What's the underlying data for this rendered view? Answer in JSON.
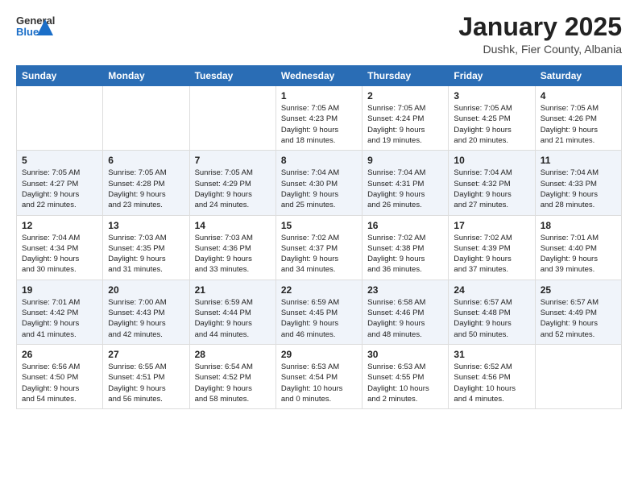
{
  "header": {
    "logo_general": "General",
    "logo_blue": "Blue",
    "calendar_title": "January 2025",
    "calendar_subtitle": "Dushk, Fier County, Albania"
  },
  "weekdays": [
    "Sunday",
    "Monday",
    "Tuesday",
    "Wednesday",
    "Thursday",
    "Friday",
    "Saturday"
  ],
  "rows": [
    [
      {
        "day": "",
        "info": ""
      },
      {
        "day": "",
        "info": ""
      },
      {
        "day": "",
        "info": ""
      },
      {
        "day": "1",
        "info": "Sunrise: 7:05 AM\nSunset: 4:23 PM\nDaylight: 9 hours\nand 18 minutes."
      },
      {
        "day": "2",
        "info": "Sunrise: 7:05 AM\nSunset: 4:24 PM\nDaylight: 9 hours\nand 19 minutes."
      },
      {
        "day": "3",
        "info": "Sunrise: 7:05 AM\nSunset: 4:25 PM\nDaylight: 9 hours\nand 20 minutes."
      },
      {
        "day": "4",
        "info": "Sunrise: 7:05 AM\nSunset: 4:26 PM\nDaylight: 9 hours\nand 21 minutes."
      }
    ],
    [
      {
        "day": "5",
        "info": "Sunrise: 7:05 AM\nSunset: 4:27 PM\nDaylight: 9 hours\nand 22 minutes."
      },
      {
        "day": "6",
        "info": "Sunrise: 7:05 AM\nSunset: 4:28 PM\nDaylight: 9 hours\nand 23 minutes."
      },
      {
        "day": "7",
        "info": "Sunrise: 7:05 AM\nSunset: 4:29 PM\nDaylight: 9 hours\nand 24 minutes."
      },
      {
        "day": "8",
        "info": "Sunrise: 7:04 AM\nSunset: 4:30 PM\nDaylight: 9 hours\nand 25 minutes."
      },
      {
        "day": "9",
        "info": "Sunrise: 7:04 AM\nSunset: 4:31 PM\nDaylight: 9 hours\nand 26 minutes."
      },
      {
        "day": "10",
        "info": "Sunrise: 7:04 AM\nSunset: 4:32 PM\nDaylight: 9 hours\nand 27 minutes."
      },
      {
        "day": "11",
        "info": "Sunrise: 7:04 AM\nSunset: 4:33 PM\nDaylight: 9 hours\nand 28 minutes."
      }
    ],
    [
      {
        "day": "12",
        "info": "Sunrise: 7:04 AM\nSunset: 4:34 PM\nDaylight: 9 hours\nand 30 minutes."
      },
      {
        "day": "13",
        "info": "Sunrise: 7:03 AM\nSunset: 4:35 PM\nDaylight: 9 hours\nand 31 minutes."
      },
      {
        "day": "14",
        "info": "Sunrise: 7:03 AM\nSunset: 4:36 PM\nDaylight: 9 hours\nand 33 minutes."
      },
      {
        "day": "15",
        "info": "Sunrise: 7:02 AM\nSunset: 4:37 PM\nDaylight: 9 hours\nand 34 minutes."
      },
      {
        "day": "16",
        "info": "Sunrise: 7:02 AM\nSunset: 4:38 PM\nDaylight: 9 hours\nand 36 minutes."
      },
      {
        "day": "17",
        "info": "Sunrise: 7:02 AM\nSunset: 4:39 PM\nDaylight: 9 hours\nand 37 minutes."
      },
      {
        "day": "18",
        "info": "Sunrise: 7:01 AM\nSunset: 4:40 PM\nDaylight: 9 hours\nand 39 minutes."
      }
    ],
    [
      {
        "day": "19",
        "info": "Sunrise: 7:01 AM\nSunset: 4:42 PM\nDaylight: 9 hours\nand 41 minutes."
      },
      {
        "day": "20",
        "info": "Sunrise: 7:00 AM\nSunset: 4:43 PM\nDaylight: 9 hours\nand 42 minutes."
      },
      {
        "day": "21",
        "info": "Sunrise: 6:59 AM\nSunset: 4:44 PM\nDaylight: 9 hours\nand 44 minutes."
      },
      {
        "day": "22",
        "info": "Sunrise: 6:59 AM\nSunset: 4:45 PM\nDaylight: 9 hours\nand 46 minutes."
      },
      {
        "day": "23",
        "info": "Sunrise: 6:58 AM\nSunset: 4:46 PM\nDaylight: 9 hours\nand 48 minutes."
      },
      {
        "day": "24",
        "info": "Sunrise: 6:57 AM\nSunset: 4:48 PM\nDaylight: 9 hours\nand 50 minutes."
      },
      {
        "day": "25",
        "info": "Sunrise: 6:57 AM\nSunset: 4:49 PM\nDaylight: 9 hours\nand 52 minutes."
      }
    ],
    [
      {
        "day": "26",
        "info": "Sunrise: 6:56 AM\nSunset: 4:50 PM\nDaylight: 9 hours\nand 54 minutes."
      },
      {
        "day": "27",
        "info": "Sunrise: 6:55 AM\nSunset: 4:51 PM\nDaylight: 9 hours\nand 56 minutes."
      },
      {
        "day": "28",
        "info": "Sunrise: 6:54 AM\nSunset: 4:52 PM\nDaylight: 9 hours\nand 58 minutes."
      },
      {
        "day": "29",
        "info": "Sunrise: 6:53 AM\nSunset: 4:54 PM\nDaylight: 10 hours\nand 0 minutes."
      },
      {
        "day": "30",
        "info": "Sunrise: 6:53 AM\nSunset: 4:55 PM\nDaylight: 10 hours\nand 2 minutes."
      },
      {
        "day": "31",
        "info": "Sunrise: 6:52 AM\nSunset: 4:56 PM\nDaylight: 10 hours\nand 4 minutes."
      },
      {
        "day": "",
        "info": ""
      }
    ]
  ]
}
